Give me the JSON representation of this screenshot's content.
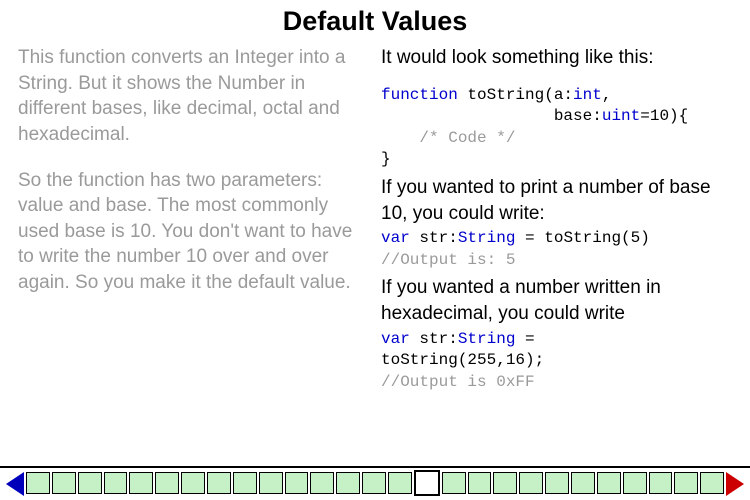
{
  "title": "Default Values",
  "left": {
    "p1": "This function converts an Integer into a String. But it shows the Number in different bases, like decimal, octal and hexadecimal.",
    "p2": "So the function has two parameters: value and base. The most commonly used base is 10. You don't want to have to write the number 10 over and over again. So you make it the default value."
  },
  "right": {
    "lead": "It would look something like this:",
    "code1": {
      "kw": "function",
      "l1_rest": " toString(a:",
      "l1_type": "int",
      "l1_end": ",",
      "l2_pad": "                  base:",
      "l2_type": "uint",
      "l2_end": "=10){",
      "l3_pad": "    ",
      "l3_comment": "/* Code */",
      "l4": "}"
    },
    "mid1": "If you wanted to print a number of base 10, you could write:",
    "code2": {
      "kw": "var",
      "rest1": " str:",
      "type": "String",
      "rest2": " = toString(5)",
      "comment": "//Output is: 5"
    },
    "mid2": "If you wanted a number written in hexadecimal, you could write",
    "code3": {
      "kw": "var",
      "rest1": " str:",
      "type": "String",
      "rest2": " =",
      "l2": "toString(255,16);",
      "comment": "//Output is 0xFF"
    }
  },
  "nav": {
    "total": 27,
    "current": 16,
    "colors": {
      "prev_arrow": "#0000bb",
      "next_arrow": "#cc0000",
      "box_fill": "#c6f0c6"
    }
  }
}
